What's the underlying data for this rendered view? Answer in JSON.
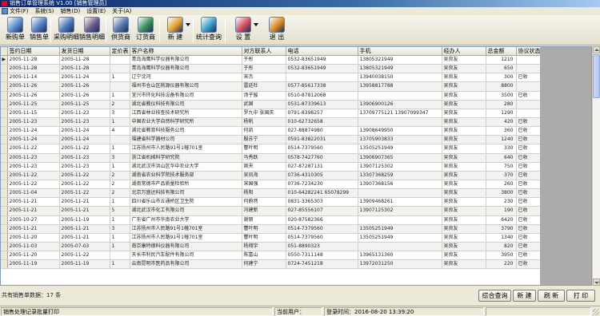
{
  "window": {
    "title": "销售订单管理系统 V1.00  [销售管理员]"
  },
  "menu": [
    "文件(F)",
    "系统(S)",
    "销售(D)",
    "设置(E)",
    "关于(A)"
  ],
  "toolbar": {
    "buttons": [
      {
        "label": "新购单",
        "icon": "new-order-icon",
        "color": "#5b8fd0"
      },
      {
        "label": "销售单",
        "icon": "sales-order-icon",
        "color": "#4f7fc4"
      },
      {
        "label": "采购明细",
        "icon": "purchase-detail-icon",
        "color": "#4a78b8"
      },
      {
        "label": "销售明细",
        "icon": "sales-detail-icon",
        "color": "#6a5a8a"
      },
      {
        "label": "供货商",
        "icon": "supplier-icon",
        "color": "#5477a8"
      },
      {
        "label": "订货商",
        "icon": "customer-icon",
        "color": "#3d8f5a"
      },
      {
        "label": "新 建",
        "icon": "new-icon",
        "color": "#e0a030"
      },
      {
        "label": "统计查询",
        "icon": "statistics-icon",
        "color": "#3aa0c8"
      },
      {
        "label": "设 置",
        "icon": "settings-icon",
        "color": "#d05060"
      },
      {
        "label": "退 出",
        "icon": "exit-icon",
        "color": "#d88a20"
      }
    ]
  },
  "grid": {
    "columns": [
      "签约日期",
      "发货日期",
      "定价表",
      "客户名称",
      "对方联系人",
      "电话",
      "手机",
      "经办人",
      "总金额",
      "协议状态"
    ],
    "rows": [
      [
        "2005-11-28",
        "2005-11-28",
        "",
        "青岛海鹰科学仪器有限公司",
        "于彤",
        "0532-83651949",
        "13805321949",
        "吴良友",
        "1210",
        ""
      ],
      [
        "2005-11-28",
        "2005-11-28",
        "",
        "青岛海鹰科学仪器有限公司",
        "于彤",
        "0532-83651949",
        "13805321949",
        "吴良友",
        "650",
        ""
      ],
      [
        "2005-11-14",
        "2005-11-24",
        "1",
        "辽宁沈河",
        "宋杰",
        "",
        "13940038150",
        "吴良友",
        "300",
        "已收"
      ],
      [
        "2005-11-26",
        "2005-11-26",
        "",
        "福州市仓山区桃源仪器有限公司",
        "雷廷杜",
        "0577-85617338",
        "13958817788",
        "吴良友",
        "8800",
        ""
      ],
      [
        "2005-11-26",
        "2005-11-26",
        "1",
        "宜兴市环化科技设备有限公司",
        "汤子骏",
        "0510-87812068",
        "",
        "吴良友",
        "3500",
        "已收"
      ],
      [
        "2005-11-25",
        "2005-11-25",
        "2",
        "湖北省教仪科技有限公司",
        "武国",
        "0531-87339613",
        "13906900126",
        "吴良友",
        "280",
        ""
      ],
      [
        "2005-11-15",
        "2005-11-23",
        "3",
        "江西省林业核查技术研究所",
        "罗九中 张国庆",
        "0791-8398257",
        "13709775121 13907099347",
        "吴良友",
        "1290",
        ""
      ],
      [
        "2005-11-23",
        "2005-11-23",
        "1",
        "中国农业大学自然科学研究所",
        "杨帆",
        "010-62732658",
        "",
        "吴良友",
        "420",
        "已收"
      ],
      [
        "2005-11-24",
        "2005-11-24",
        "4",
        "湖北省教育科技服务公司",
        "何凯",
        "027-88874980",
        "13908649950",
        "吴良友",
        "360",
        "已收"
      ],
      [
        "2005-11-24",
        "2005-11-24",
        "",
        "福建省科学器材公司",
        "殷苏宁",
        "0591-83822031",
        "13705903833",
        "吴良友",
        "1240",
        "已收"
      ],
      [
        "2005-11-22",
        "2005-11-22",
        "1",
        "江苏扬州市人民路91号1幢701室",
        "曹叶明",
        "0514-7379560",
        "13505251949",
        "吴良友",
        "330",
        "已收"
      ],
      [
        "2005-11-23",
        "2005-11-23",
        "3",
        "浙江省机械科学研究院",
        "马秀跃",
        "0578-7427760",
        "13906907365",
        "吴良友",
        "640",
        "已收"
      ],
      [
        "2005-11-23",
        "2005-11-23",
        "1",
        "湖北武汉市洪山区华中农业大学",
        "周天",
        "027-87287131",
        "13907125302",
        "吴良友",
        "750",
        "已收"
      ],
      [
        "2005-11-22",
        "2005-11-22",
        "2",
        "湖南省农业科学院技术服务部",
        "吴凤海",
        "0736-4310305",
        "13307368259",
        "吴良友",
        "370",
        "已收"
      ],
      [
        "2005-11-22",
        "2005-11-22",
        "2",
        "湖南常德市产品质量检验所",
        "宋国强",
        "0736-7234230",
        "13907368156",
        "吴良友",
        "260",
        "已收"
      ],
      [
        "2005-11-04",
        "2005-11-22",
        "2",
        "北京万盛达科技有限公司",
        "杨阳",
        "010-64282241  65078299",
        "",
        "吴良友",
        "3800",
        "已收"
      ],
      [
        "2005-11-21",
        "2005-11-21",
        "1",
        "四川省乐山市五通桥区卫生院",
        "何蔚然",
        "0831-3365303",
        "13909468261",
        "吴良友",
        "230",
        "已收"
      ],
      [
        "2005-11-21",
        "2005-11-21",
        "5",
        "湖北武汉市化工有限公司",
        "冯建新",
        "027-85556107",
        "13907125302",
        "吴良友",
        "190",
        "已收"
      ],
      [
        "2005-10-27",
        "2005-11-19",
        "1",
        "广东省广州市华南农业大学",
        "谢丽",
        "020-87582366",
        "",
        "吴良友",
        "6420",
        "已收"
      ],
      [
        "2005-11-21",
        "2005-11-21",
        "3",
        "江苏扬州市人民路91号1幢701室",
        "曹叶明",
        "0514-7379560",
        "13505251949",
        "吴良友",
        "3790",
        "已收"
      ],
      [
        "2005-11-20",
        "2005-11-21",
        "1",
        "江苏扬州市人民路91号1幢701室",
        "曹叶明",
        "0514-7379560",
        "13505251949",
        "吴良友",
        "1340",
        "已收"
      ],
      [
        "2005-11-03",
        "2005-07-03",
        "1",
        "南京康特德科仪器有限公司",
        "杨翔宇",
        "051-8890323",
        "",
        "吴良友",
        "820",
        "已收"
      ],
      [
        "2005-11-20",
        "2005-11-22",
        "",
        "天长市利民汽车配件有限公司",
        "陈富山",
        "0550-7311148",
        "13965131360",
        "吴良友",
        "3950",
        "已收"
      ],
      [
        "2005-11-19",
        "2005-11-19",
        "1",
        "云南昆明市医药品有限公司",
        "何建宁",
        "0724-7451218",
        "13972031250",
        "吴良友",
        "220",
        "已收"
      ]
    ]
  },
  "bottom": {
    "count_label": "共有销售单数据：17 条",
    "buttons": [
      "综合查询",
      "新 建",
      "刷 新",
      "打 印"
    ]
  },
  "status": {
    "left": "销售处理记录批量打印",
    "user": "当前用户：",
    "login": "登录时间：2016-08-20 13:39:20"
  }
}
